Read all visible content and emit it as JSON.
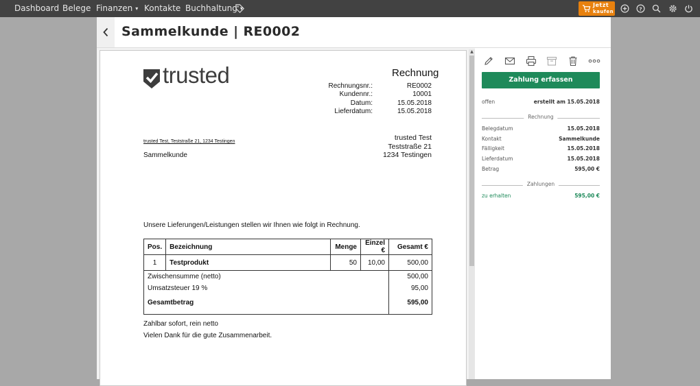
{
  "nav": {
    "items": [
      {
        "label": "Dashboard"
      },
      {
        "label": "Belege"
      },
      {
        "label": "Finanzen"
      },
      {
        "label": "Kontakte"
      },
      {
        "label": "Buchhaltung"
      }
    ],
    "buy_line1": "Jetzt",
    "buy_line2": "kaufen",
    "icons": [
      "tag-icon",
      "plus-circle-icon",
      "help-icon",
      "search-icon",
      "gear-icon",
      "power-icon"
    ]
  },
  "title": "Sammelkunde | RE0002",
  "invoice": {
    "logo_text": "trusted",
    "doc_title": "Rechnung",
    "meta": [
      {
        "label": "Rechnungsnr.:",
        "value": "RE0002"
      },
      {
        "label": "Kundennr.:",
        "value": "10001"
      },
      {
        "label": "Datum:",
        "value": "15.05.2018"
      },
      {
        "label": "Lieferdatum:",
        "value": "15.05.2018"
      }
    ],
    "sender_address": [
      "trusted Test",
      "Teststraße 21",
      "1234 Testingen"
    ],
    "sender_line": "trusted Test, Teststraße 21, 1234 Testingen",
    "recipient": "Sammelkunde",
    "intro": "Unsere Lieferungen/Leistungen stellen wir Ihnen wie folgt in Rechnung.",
    "table": {
      "headers": [
        "Pos.",
        "Bezeichnung",
        "Menge",
        "Einzel €",
        "Gesamt €"
      ],
      "rows": [
        {
          "pos": "1",
          "name": "Testprodukt",
          "qty": "50",
          "unit": "10,00",
          "total": "500,00"
        }
      ],
      "subtotal_label": "Zwischensumme (netto)",
      "subtotal_value": "500,00",
      "tax_label": "Umsatzsteuer 19 %",
      "tax_value": "95,00",
      "total_label": "Gesamtbetrag",
      "total_value": "595,00"
    },
    "footer1": "Zahlbar sofort, rein netto",
    "footer2": "Vielen Dank für die gute Zusammenarbeit."
  },
  "sidebar": {
    "actions": [
      "edit-icon",
      "mail-icon",
      "print-icon",
      "archive-icon",
      "trash-icon",
      "more-icon"
    ],
    "primary_button": "Zahlung erfassen",
    "status": "offen",
    "created": "erstellt am 15.05.2018",
    "section_invoice": "Rechnung",
    "details": [
      {
        "label": "Belegdatum",
        "value": "15.05.2018"
      },
      {
        "label": "Kontakt",
        "value": "Sammelkunde"
      },
      {
        "label": "Fälligkeit",
        "value": "15.05.2018"
      },
      {
        "label": "Lieferdatum",
        "value": "15.05.2018"
      },
      {
        "label": "Betrag",
        "value": "595,00 €"
      }
    ],
    "section_payments": "Zahlungen",
    "receivable_label": "zu erhalten",
    "receivable_value": "595,00 €"
  },
  "colors": {
    "nav_bg": "#424242",
    "accent_orange": "#e8810e",
    "primary_green": "#1e8a5a"
  }
}
